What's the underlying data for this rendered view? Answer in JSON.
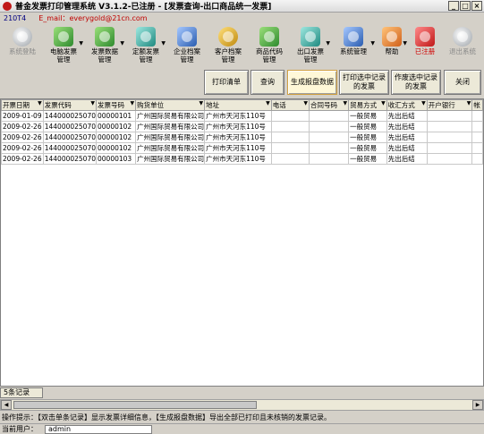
{
  "window": {
    "title": "普金发票打印管理系统 V3.1.2-已注册 - [发票查询-出口商品统一发票]",
    "minimize": "_",
    "maximize": "□",
    "close": "×"
  },
  "info": {
    "code": "210T4",
    "email": "E_mail：everygold@21cn.com"
  },
  "toolbar": {
    "items": [
      {
        "label": "系统登陆",
        "icon": "disc-icon"
      },
      {
        "label": "电脑发票\n管理",
        "icon": "invoice-icon"
      },
      {
        "label": "发票数据\n管理",
        "icon": "edit-icon"
      },
      {
        "label": "定额发票\n管理",
        "icon": "globe-icon"
      },
      {
        "label": "企业档案\n管理",
        "icon": "folder-icon"
      },
      {
        "label": "客户档案\n管理",
        "icon": "customer-icon"
      },
      {
        "label": "商品代码\n管理",
        "icon": "goods-icon"
      },
      {
        "label": "出口发票\n管理",
        "icon": "export-icon"
      },
      {
        "label": "系统管理",
        "icon": "tools-icon"
      },
      {
        "label": "帮助",
        "icon": "help-icon"
      },
      {
        "label": "已注册",
        "icon": "registered-icon"
      },
      {
        "label": "退出系统",
        "icon": "exit-icon"
      }
    ]
  },
  "actions": {
    "print_list": "打印清单",
    "query": "查询",
    "generate_report": "生成报盘数据",
    "print_selected": "打印选中记录\n的发票",
    "void_selected": "作废选中记录\n的发票",
    "close": "关闭"
  },
  "table": {
    "columns": [
      "开票日期",
      "发票代码",
      "发票号码",
      "购货单位",
      "地址",
      "电话",
      "合同号码",
      "贸易方式",
      "收汇方式",
      "开户银行",
      "帐"
    ],
    "rows": [
      [
        "2009-01-09",
        "144000025070",
        "00000101",
        "广州国际贸易有限公司",
        "广州市天河东110号",
        "",
        "",
        "一般贸易",
        "先出后结",
        "",
        ""
      ],
      [
        "2009-02-26",
        "144000025070",
        "00000102",
        "广州国际贸易有限公司",
        "广州市天河东110号",
        "",
        "",
        "一般贸易",
        "先出后结",
        "",
        ""
      ],
      [
        "2009-02-26",
        "144000025070",
        "00000102",
        "广州国际贸易有限公司",
        "广州市天河东110号",
        "",
        "",
        "一般贸易",
        "先出后结",
        "",
        ""
      ],
      [
        "2009-02-26",
        "144000025070",
        "00000102",
        "广州国际贸易有限公司",
        "广州市天河东110号",
        "",
        "",
        "一般贸易",
        "先出后结",
        "",
        ""
      ],
      [
        "2009-02-26",
        "144000025070",
        "00000103",
        "广州国际贸易有限公司",
        "广州市天河东110号",
        "",
        "",
        "一般贸易",
        "先出后结",
        "",
        ""
      ]
    ]
  },
  "record_count": "5条记录",
  "scroll_left": "◀",
  "scroll_right": "▶",
  "hint": "操作提示：【双击单条记录】显示发票详细信息，【生成报盘数据】导出全部已打印且未核销的发票记录。",
  "status": {
    "label": "当前用户：",
    "user": "admin"
  }
}
